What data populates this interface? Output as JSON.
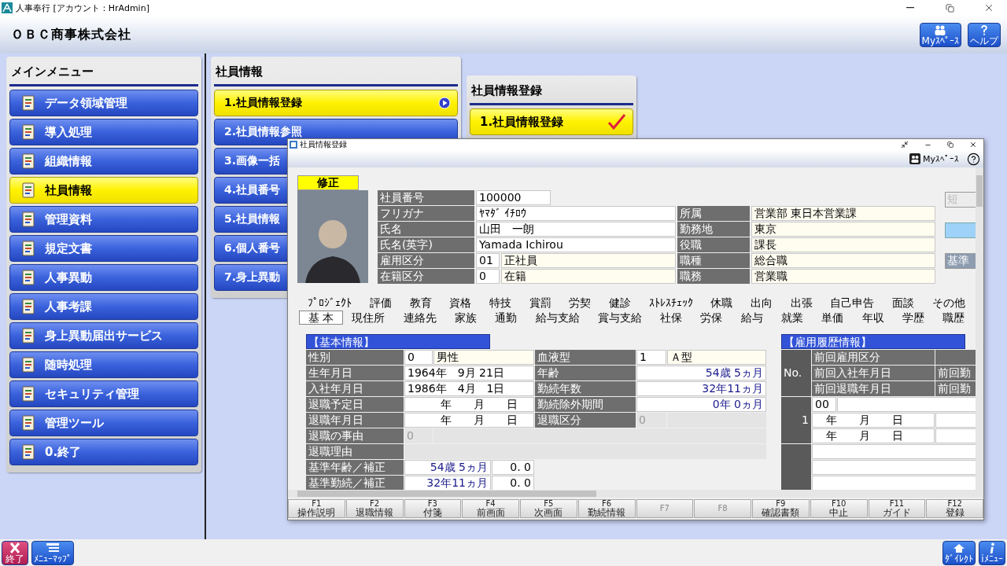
{
  "window": {
    "title": "人事奉行 [アカウント：HrAdmin]"
  },
  "header": {
    "company": "ＯＢＣ商事株式会社",
    "buttons": [
      {
        "kind": "myspace",
        "label": "Myｽﾍﾟｰｽ"
      },
      {
        "kind": "help",
        "label": "ヘルプ"
      }
    ]
  },
  "main_menu": {
    "title": "メインメニュー",
    "items": [
      {
        "label": "データ領域管理",
        "selected": false
      },
      {
        "label": "導入処理",
        "selected": false
      },
      {
        "label": "組織情報",
        "selected": false
      },
      {
        "label": "社員情報",
        "selected": true
      },
      {
        "label": "管理資料",
        "selected": false
      },
      {
        "label": "規定文書",
        "selected": false
      },
      {
        "label": "人事異動",
        "selected": false
      },
      {
        "label": "人事考課",
        "selected": false
      },
      {
        "label": "身上異動届出サービス",
        "selected": false
      },
      {
        "label": "随時処理",
        "selected": false
      },
      {
        "label": "セキュリティ管理",
        "selected": false
      },
      {
        "label": "管理ツール",
        "selected": false
      },
      {
        "label": "0.終了",
        "selected": false
      }
    ]
  },
  "submenu": {
    "title": "社員情報",
    "items": [
      {
        "label": "1.社員情報登録",
        "selected": true
      },
      {
        "label": "2.社員情報参照",
        "selected": false
      },
      {
        "label": "3.画像一括",
        "selected": false
      },
      {
        "label": "4.社員番号",
        "selected": false
      },
      {
        "label": "5.社員情報",
        "selected": false
      },
      {
        "label": "6.個人番号",
        "selected": false
      },
      {
        "label": "7.身上異動",
        "selected": false
      }
    ]
  },
  "submenu2": {
    "title": "社員情報登録",
    "items": [
      {
        "label": "1.社員情報登録",
        "selected": true
      }
    ]
  },
  "dialog": {
    "title": "社員情報登録",
    "myspace": "Myｽﾍﾟｰｽ",
    "mode": "修正",
    "profile": [
      {
        "label": "社員番号",
        "kind": "short",
        "value": "100000"
      },
      {
        "label": "フリガナ",
        "kind": "text",
        "value": "ﾔﾏﾀﾞ ｲﾁﾛｳ",
        "right_label": "所属",
        "right_value": "営業部 東日本営業課"
      },
      {
        "label": "氏名",
        "kind": "text",
        "value": "山田　一朗",
        "right_label": "勤務地",
        "right_value": "東京"
      },
      {
        "label": "氏名(英字)",
        "kind": "text",
        "value": "Yamada Ichirou",
        "right_label": "役職",
        "right_value": "課長"
      },
      {
        "label": "雇用区分",
        "kind": "coded",
        "code": "01",
        "value": "正社員",
        "right_label": "職種",
        "right_value": "総合職"
      },
      {
        "label": "在籍区分",
        "kind": "coded",
        "code": "0",
        "value": "在籍",
        "right_label": "職務",
        "right_value": "営業職"
      }
    ],
    "side_buttons": [
      {
        "kind": "button",
        "label": "短",
        "disabled": true
      },
      {
        "kind": "color"
      },
      {
        "kind": "button",
        "label": "基準",
        "disabled": false
      }
    ],
    "tabs": [
      [
        {
          "label": "ﾌﾟﾛｼﾞｪｸﾄ",
          "selected": false
        },
        {
          "label": "評価",
          "selected": false
        },
        {
          "label": "教育",
          "selected": false
        },
        {
          "label": "資格",
          "selected": false
        },
        {
          "label": "特技",
          "selected": false
        },
        {
          "label": "賞罰",
          "selected": false
        },
        {
          "label": "労契",
          "selected": false
        },
        {
          "label": "健診",
          "selected": false
        },
        {
          "label": "ｽﾄﾚｽﾁｪｯｸ",
          "selected": false
        },
        {
          "label": "休職",
          "selected": false
        },
        {
          "label": "出向",
          "selected": false
        },
        {
          "label": "出張",
          "selected": false
        },
        {
          "label": "自己申告",
          "selected": false
        },
        {
          "label": "面談",
          "selected": false
        },
        {
          "label": "その他",
          "selected": false
        }
      ],
      [
        {
          "label": "基 本",
          "selected": true
        },
        {
          "label": "現住所",
          "selected": false
        },
        {
          "label": "連絡先",
          "selected": false
        },
        {
          "label": "家族",
          "selected": false
        },
        {
          "label": "通勤",
          "selected": false
        },
        {
          "label": "給与支給",
          "selected": false
        },
        {
          "label": "賞与支給",
          "selected": false
        },
        {
          "label": "社保",
          "selected": false
        },
        {
          "label": "労保",
          "selected": false
        },
        {
          "label": "給与",
          "selected": false
        },
        {
          "label": "就業",
          "selected": false
        },
        {
          "label": "単価",
          "selected": false
        },
        {
          "label": "年収",
          "selected": false
        },
        {
          "label": "学歴",
          "selected": false
        },
        {
          "label": "職歴",
          "selected": false
        }
      ]
    ],
    "basic": {
      "title": "【基本情報】",
      "rows": [
        {
          "label": "性別",
          "kind": "coded",
          "code": "0",
          "value": "男性",
          "right": {
            "label": "血液型",
            "kind": "coded",
            "code": "1",
            "value": "Ａ型"
          }
        },
        {
          "label": "生年月日",
          "kind": "text",
          "value": "1964年　9月 21日",
          "right": {
            "label": "年齢",
            "kind": "derived",
            "value": "54歳 5ヵ月"
          }
        },
        {
          "label": "入社年月日",
          "kind": "text",
          "value": "1986年　4月　1日",
          "right": {
            "label": "勤続年数",
            "kind": "derived",
            "value": "32年11ヵ月"
          }
        },
        {
          "label": "退職予定日",
          "kind": "text",
          "value": "　　　年　　月　　日",
          "right": {
            "label": "勤続除外期間",
            "kind": "derived",
            "value": "0年 0ヵ月"
          }
        },
        {
          "label": "退職年月日",
          "kind": "text",
          "value": "　　　年　　月　　日",
          "right": {
            "label": "退職区分",
            "kind": "disabled",
            "code": "0"
          }
        },
        {
          "label": "退職の事由",
          "kind": "disabled_wide",
          "code": "0"
        },
        {
          "label": "退職理由",
          "kind": "disabled_wide"
        },
        {
          "label": "基準年齢／補正",
          "kind": "adjust",
          "value": "54歳 5ヵ月",
          "adjustment": "0. 0"
        },
        {
          "label": "基準勤続／補正",
          "kind": "adjust",
          "value": "32年11ヵ月",
          "adjustment": "0. 0"
        }
      ]
    },
    "history": {
      "title": "【雇用履歴情報】",
      "no_header": "No.",
      "headers": [
        "前回雇用区分",
        "前回入社年月日",
        "前回退職年月日"
      ],
      "extra_headers": [
        "前回勤",
        "前回勤"
      ],
      "records": [
        {
          "no": "1",
          "code": "00",
          "hire_date": "　年　　月　　日",
          "leave_date": "　年　　月　　日"
        }
      ]
    },
    "function_keys": [
      {
        "key": "F1",
        "label": "操作説明",
        "disabled": false
      },
      {
        "key": "F2",
        "label": "退職情報",
        "disabled": false
      },
      {
        "key": "F3",
        "label": "付箋",
        "disabled": false
      },
      {
        "key": "F4",
        "label": "前画面",
        "disabled": false
      },
      {
        "key": "F5",
        "label": "次画面",
        "disabled": false
      },
      {
        "key": "F6",
        "label": "勤続情報",
        "disabled": false
      },
      {
        "key": "F7",
        "disabled": true
      },
      {
        "key": "F8",
        "disabled": true
      },
      {
        "key": "F9",
        "label": "確認書類",
        "disabled": false
      },
      {
        "key": "F10",
        "label": "中止",
        "disabled": false
      },
      {
        "key": "F11",
        "label": "ガイド",
        "disabled": false
      },
      {
        "key": "F12",
        "label": "登録",
        "disabled": false
      }
    ]
  },
  "footer": {
    "left": [
      {
        "kind": "exit",
        "label": "終了"
      },
      {
        "kind": "map",
        "label": "ﾒﾆｭｰﾏｯﾌﾟ"
      }
    ],
    "right": [
      {
        "kind": "direct",
        "label": "ﾀﾞｲﾚｸﾄ"
      },
      {
        "kind": "info",
        "label": "iﾒﾆｭｰ"
      }
    ]
  }
}
